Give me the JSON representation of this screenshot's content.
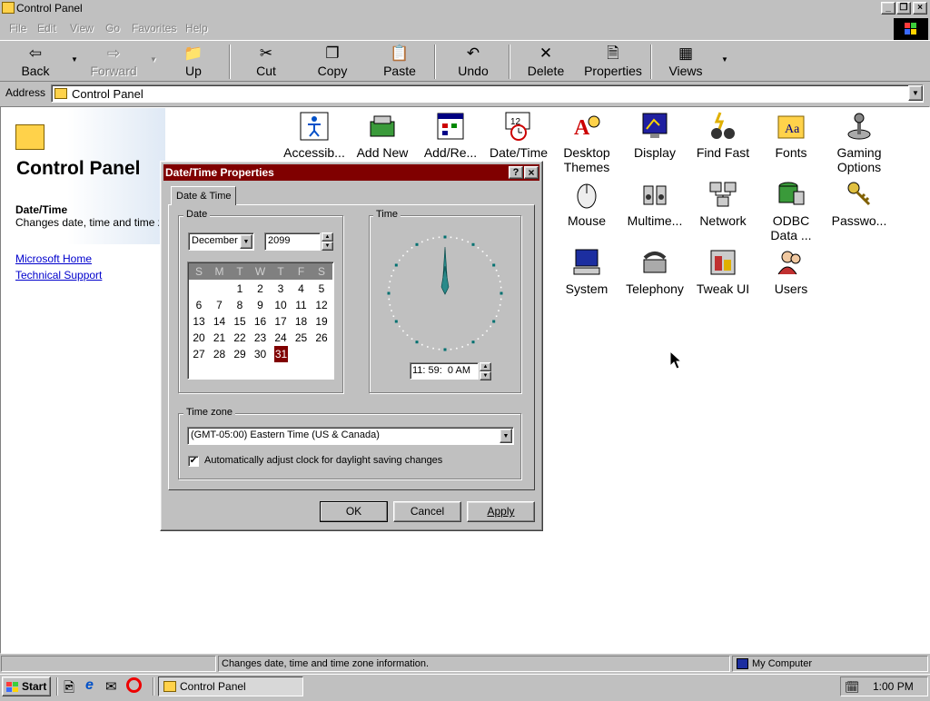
{
  "window": {
    "title": "Control Panel"
  },
  "menu": [
    "File",
    "Edit",
    "View",
    "Go",
    "Favorites",
    "Help"
  ],
  "toolbar": {
    "back": "Back",
    "forward": "Forward",
    "up": "Up",
    "cut": "Cut",
    "copy": "Copy",
    "paste": "Paste",
    "undo": "Undo",
    "delete": "Delete",
    "properties": "Properties",
    "views": "Views"
  },
  "address": {
    "label": "Address",
    "value": "Control Panel"
  },
  "left": {
    "heading": "Control Panel",
    "item_title": "Date/Time",
    "item_desc": "Changes date, time and time zone information.",
    "link1": "Microsoft Home",
    "link2": "Technical Support"
  },
  "icons": [
    {
      "label": "Accessib..."
    },
    {
      "label": "Add New"
    },
    {
      "label": "Add/Re..."
    },
    {
      "label": "Date/Time"
    },
    {
      "label": "Desktop Themes"
    },
    {
      "label": "Display"
    },
    {
      "label": "Find Fast"
    },
    {
      "label": "Fonts"
    },
    {
      "label": "Gaming Options"
    },
    {
      "label": "Mouse"
    },
    {
      "label": "Multime..."
    },
    {
      "label": "Network"
    },
    {
      "label": "ODBC Data ..."
    },
    {
      "label": "Passwo..."
    },
    {
      "label": "System"
    },
    {
      "label": "Telephony"
    },
    {
      "label": "Tweak UI"
    },
    {
      "label": "Users"
    }
  ],
  "dialog": {
    "title": "Date/Time Properties",
    "tab": "Date & Time",
    "date_group": "Date",
    "time_group": "Time",
    "month": "December",
    "year": "2099",
    "weekdays": [
      "S",
      "M",
      "T",
      "W",
      "T",
      "F",
      "S"
    ],
    "calendar_rows": [
      [
        "",
        "",
        "1",
        "2",
        "3",
        "4",
        "5"
      ],
      [
        "6",
        "7",
        "8",
        "9",
        "10",
        "11",
        "12"
      ],
      [
        "13",
        "14",
        "15",
        "16",
        "17",
        "18",
        "19"
      ],
      [
        "20",
        "21",
        "22",
        "23",
        "24",
        "25",
        "26"
      ],
      [
        "27",
        "28",
        "29",
        "30",
        "31",
        "",
        ""
      ]
    ],
    "selected_day": "31",
    "time": "11: 59:  0 AM",
    "timezone_group": "Time zone",
    "timezone": "(GMT-05:00) Eastern Time (US & Canada)",
    "dst_label": "Automatically adjust clock for daylight saving changes",
    "ok": "OK",
    "cancel": "Cancel",
    "apply": "Apply"
  },
  "status": {
    "text": "Changes date, time and time zone information.",
    "zone": "My Computer"
  },
  "taskbar": {
    "start": "Start",
    "task": "Control Panel",
    "clock": "1:00 PM"
  },
  "colors": {
    "dialog_title": "#800000",
    "selected_day": "#800000",
    "link": "#0000cc"
  }
}
